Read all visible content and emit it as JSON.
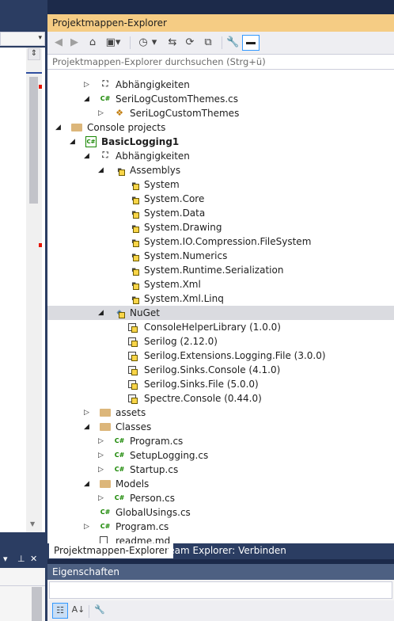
{
  "solution_explorer": {
    "title": "Projektmappen-Explorer",
    "search_placeholder": "Projektmappen-Explorer durchsuchen (Strg+ü)",
    "tree": [
      {
        "label": "Abhängigkeiten",
        "icon": "dependencies-icon",
        "level": 2,
        "expander": "collapsed",
        "bold": false
      },
      {
        "label": "SeriLogCustomThemes.cs",
        "icon": "csharp-file-icon",
        "level": 2,
        "expander": "expanded",
        "bold": false
      },
      {
        "label": "SeriLogCustomThemes",
        "icon": "class-icon",
        "level": 3,
        "expander": "collapsed",
        "bold": false
      },
      {
        "label": "Console projects",
        "icon": "solution-folder-icon",
        "level": 0,
        "expander": "expanded",
        "bold": false
      },
      {
        "label": "BasicLogging1",
        "icon": "csharp-project-icon",
        "level": 1,
        "expander": "expanded",
        "bold": true
      },
      {
        "label": "Abhängigkeiten",
        "icon": "dependencies-icon",
        "level": 2,
        "expander": "expanded",
        "bold": false
      },
      {
        "label": "Assemblys",
        "icon": "assemblies-warning-icon",
        "level": 3,
        "expander": "expanded",
        "bold": false
      },
      {
        "label": "System",
        "icon": "assembly-warning-icon",
        "level": 4,
        "expander": "none",
        "bold": false
      },
      {
        "label": "System.Core",
        "icon": "assembly-warning-icon",
        "level": 4,
        "expander": "none",
        "bold": false
      },
      {
        "label": "System.Data",
        "icon": "assembly-warning-icon",
        "level": 4,
        "expander": "none",
        "bold": false
      },
      {
        "label": "System.Drawing",
        "icon": "assembly-warning-icon",
        "level": 4,
        "expander": "none",
        "bold": false
      },
      {
        "label": "System.IO.Compression.FileSystem",
        "icon": "assembly-warning-icon",
        "level": 4,
        "expander": "none",
        "bold": false
      },
      {
        "label": "System.Numerics",
        "icon": "assembly-warning-icon",
        "level": 4,
        "expander": "none",
        "bold": false
      },
      {
        "label": "System.Runtime.Serialization",
        "icon": "assembly-warning-icon",
        "level": 4,
        "expander": "none",
        "bold": false
      },
      {
        "label": "System.Xml",
        "icon": "assembly-warning-icon",
        "level": 4,
        "expander": "none",
        "bold": false
      },
      {
        "label": "System.Xml.Linq",
        "icon": "assembly-warning-icon",
        "level": 4,
        "expander": "none",
        "bold": false
      },
      {
        "label": "NuGet",
        "icon": "nuget-warning-icon",
        "level": 3,
        "expander": "expanded",
        "bold": false,
        "selected": true
      },
      {
        "label": "ConsoleHelperLibrary (1.0.0)",
        "icon": "package-warning-icon",
        "level": 4,
        "expander": "none",
        "bold": false
      },
      {
        "label": "Serilog (2.12.0)",
        "icon": "package-warning-icon",
        "level": 4,
        "expander": "none",
        "bold": false
      },
      {
        "label": "Serilog.Extensions.Logging.File (3.0.0)",
        "icon": "package-warning-icon",
        "level": 4,
        "expander": "none",
        "bold": false
      },
      {
        "label": "Serilog.Sinks.Console (4.1.0)",
        "icon": "package-warning-icon",
        "level": 4,
        "expander": "none",
        "bold": false
      },
      {
        "label": "Serilog.Sinks.File (5.0.0)",
        "icon": "package-warning-icon",
        "level": 4,
        "expander": "none",
        "bold": false
      },
      {
        "label": "Spectre.Console (0.44.0)",
        "icon": "package-warning-icon",
        "level": 4,
        "expander": "none",
        "bold": false
      },
      {
        "label": "assets",
        "icon": "folder-icon",
        "level": 2,
        "expander": "collapsed",
        "bold": false
      },
      {
        "label": "Classes",
        "icon": "folder-icon",
        "level": 2,
        "expander": "expanded",
        "bold": false
      },
      {
        "label": "Program.cs",
        "icon": "csharp-file-icon",
        "level": 3,
        "expander": "collapsed",
        "bold": false
      },
      {
        "label": "SetupLogging.cs",
        "icon": "csharp-file-icon",
        "level": 3,
        "expander": "collapsed",
        "bold": false
      },
      {
        "label": "Startup.cs",
        "icon": "csharp-file-icon",
        "level": 3,
        "expander": "collapsed",
        "bold": false
      },
      {
        "label": "Models",
        "icon": "folder-icon",
        "level": 2,
        "expander": "expanded",
        "bold": false
      },
      {
        "label": "Person.cs",
        "icon": "csharp-file-icon",
        "level": 3,
        "expander": "collapsed",
        "bold": false
      },
      {
        "label": "GlobalUsings.cs",
        "icon": "csharp-file-icon",
        "level": 2,
        "expander": "none",
        "bold": false
      },
      {
        "label": "Program.cs",
        "icon": "csharp-file-icon",
        "level": 2,
        "expander": "collapsed",
        "bold": false
      },
      {
        "label": "readme.md",
        "icon": "markdown-file-icon",
        "level": 2,
        "expander": "none",
        "bold": false
      }
    ],
    "tabs": [
      {
        "label": "Projektmappen-Explorer",
        "active": true
      },
      {
        "label": "Team Explorer: Verbinden",
        "active": false
      }
    ]
  },
  "properties": {
    "title": "Eigenschaften"
  },
  "colors": {
    "title_active": "#f5cc84",
    "selection": "#dadbe0",
    "chrome": "#2b3d62"
  }
}
